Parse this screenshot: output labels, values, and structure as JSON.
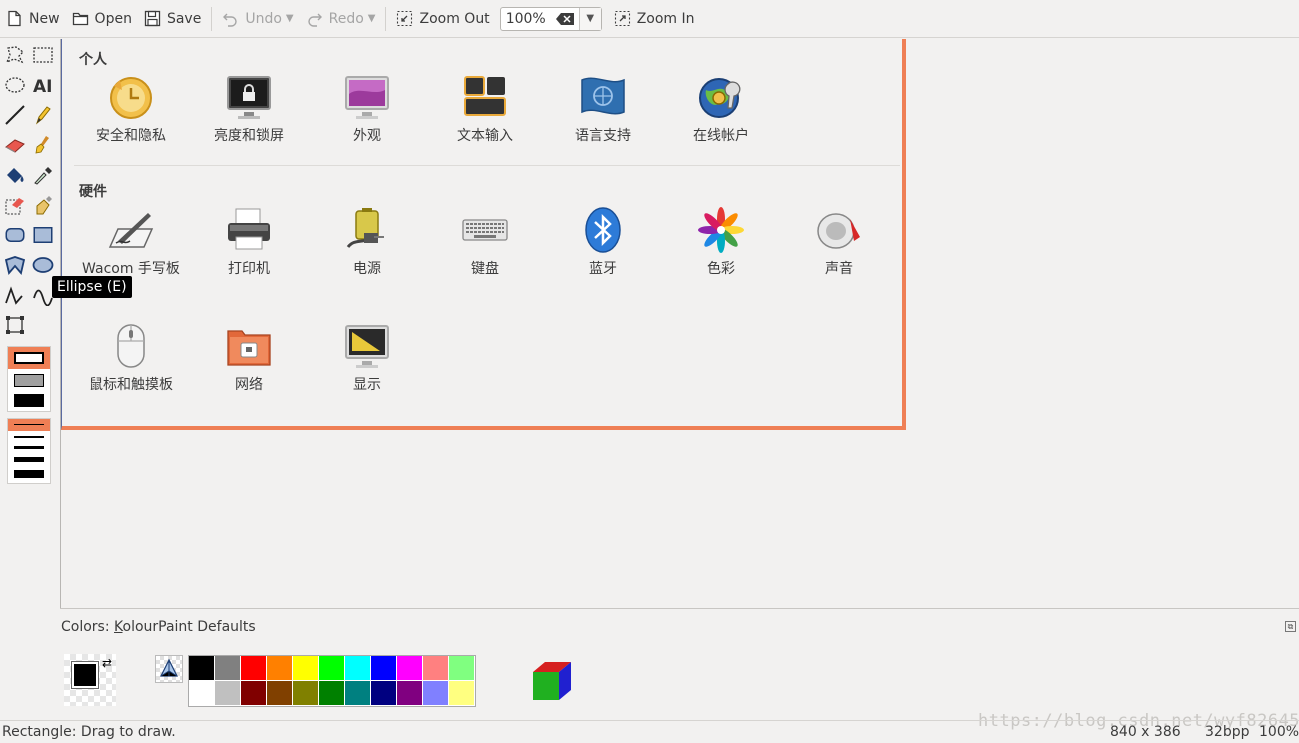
{
  "toolbar": {
    "new": "New",
    "open": "Open",
    "save": "Save",
    "undo": "Undo",
    "redo": "Redo",
    "zoom_out": "Zoom Out",
    "zoom_value": "100%",
    "zoom_in": "Zoom In"
  },
  "tooltip": "Ellipse (E)",
  "image": {
    "personal_title": "个人",
    "hardware_title": "硬件",
    "personal": [
      {
        "label": "安全和隐私",
        "icon": "security-privacy-icon"
      },
      {
        "label": "亮度和锁屏",
        "icon": "brightness-lock-icon"
      },
      {
        "label": "外观",
        "icon": "appearance-icon"
      },
      {
        "label": "文本输入",
        "icon": "text-entry-icon"
      },
      {
        "label": "语言支持",
        "icon": "language-support-icon"
      },
      {
        "label": "在线帐户",
        "icon": "online-accounts-icon"
      }
    ],
    "hardware": [
      {
        "label": "Wacom 手写板",
        "icon": "wacom-tablet-icon"
      },
      {
        "label": "打印机",
        "icon": "printer-icon"
      },
      {
        "label": "电源",
        "icon": "power-icon"
      },
      {
        "label": "键盘",
        "icon": "keyboard-icon"
      },
      {
        "label": "蓝牙",
        "icon": "bluetooth-icon"
      },
      {
        "label": "色彩",
        "icon": "color-icon"
      },
      {
        "label": "声音",
        "icon": "sound-icon"
      },
      {
        "label": "鼠标和触摸板",
        "icon": "mouse-touchpad-icon"
      },
      {
        "label": "网络",
        "icon": "network-icon"
      },
      {
        "label": "显示",
        "icon": "display-icon"
      }
    ]
  },
  "colors_panel": {
    "label_prefix": "Colors: ",
    "label_underlined": "K",
    "label_rest": "olourPaint Defaults",
    "palette_top": [
      "#000000",
      "#808080",
      "#ff0000",
      "#ff8000",
      "#ffff00",
      "#00ff00",
      "#00ffff",
      "#0000ff",
      "#ff00ff",
      "#ff8080",
      "#80ff80"
    ],
    "palette_bottom": [
      "#ffffff",
      "#c0c0c0",
      "#800000",
      "#804000",
      "#808000",
      "#008000",
      "#008080",
      "#000080",
      "#800080",
      "#8080ff",
      "#ffff80"
    ]
  },
  "status": {
    "message": "Rectangle: Drag to draw.",
    "dimensions": "840 x 386",
    "bpp": "32bpp",
    "zoom": "100%"
  },
  "watermark": "https://blog.csdn.net/wyf826459"
}
